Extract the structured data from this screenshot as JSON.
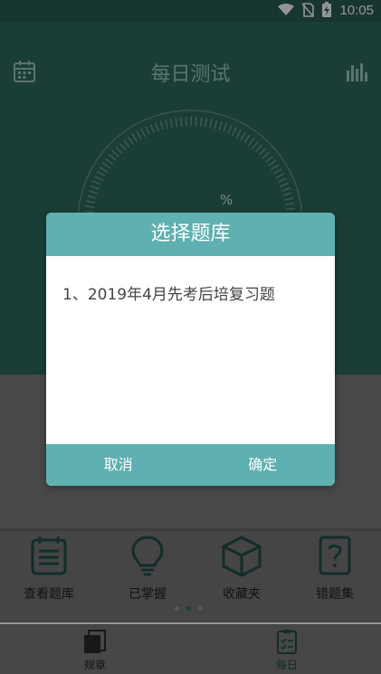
{
  "status": {
    "time": "10:05"
  },
  "header": {
    "title": "每日测试",
    "percent_sign": "%"
  },
  "grid": [
    {
      "label": "查看题库",
      "icon": "book-list-icon"
    },
    {
      "label": "已掌握",
      "icon": "bulb-icon"
    },
    {
      "label": "收藏夹",
      "icon": "box-icon"
    },
    {
      "label": "错题集",
      "icon": "question-book-icon"
    }
  ],
  "tabs": [
    {
      "label": "规章",
      "icon": "rules-icon"
    },
    {
      "label": "每日",
      "icon": "daily-checklist-icon"
    }
  ],
  "dialog": {
    "title": "选择题库",
    "items": [
      "1、2019年4月先考后培复习题"
    ],
    "cancel": "取消",
    "confirm": "确定"
  },
  "colors": {
    "primary": "#2f6a61",
    "dialog_accent": "#5fb0b0"
  }
}
